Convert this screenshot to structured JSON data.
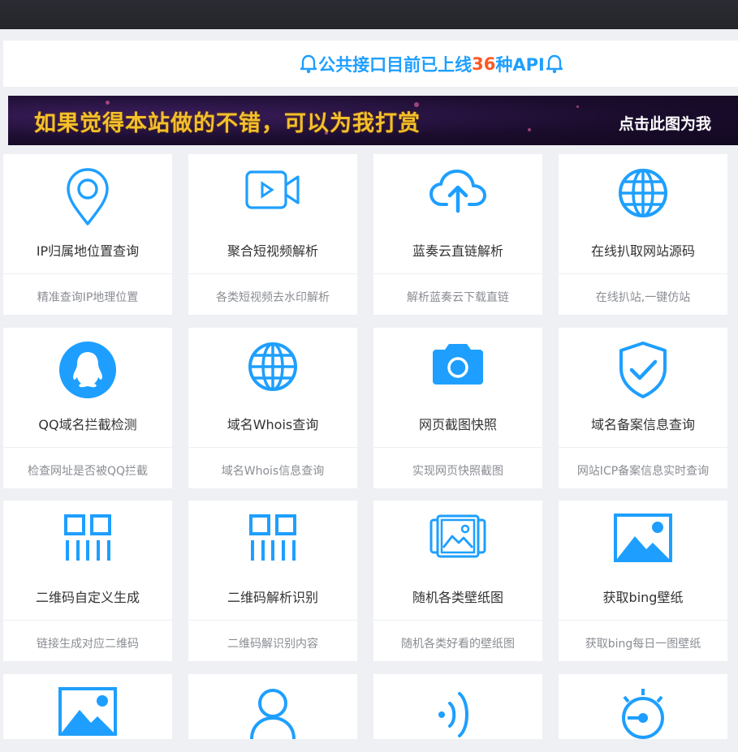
{
  "notice": {
    "prefix": "公共接口目前已上线",
    "count": "36",
    "suffix": "种API"
  },
  "banner": {
    "text": "如果觉得本站做的不错，可以为我打赏",
    "side_text": "点击此图为我"
  },
  "colors": {
    "accent": "#1e9fff",
    "highlight": "#ff5722",
    "banner_gold": "#f4c02c"
  },
  "cards": [
    {
      "icon": "location-pin-icon",
      "title": "IP归属地位置查询",
      "desc": "精准查询IP地理位置"
    },
    {
      "icon": "video-camera-icon",
      "title": "聚合短视频解析",
      "desc": "各类短视频去水印解析"
    },
    {
      "icon": "cloud-upload-icon",
      "title": "蓝奏云直链解析",
      "desc": "解析蓝奏云下载直链"
    },
    {
      "icon": "globe-icon",
      "title": "在线扒取网站源码",
      "desc": "在线扒站,一键仿站"
    },
    {
      "icon": "qq-penguin-icon",
      "title": "QQ域名拦截检测",
      "desc": "检查网址是否被QQ拦截"
    },
    {
      "icon": "globe-icon",
      "title": "域名Whois查询",
      "desc": "域名Whois信息查询"
    },
    {
      "icon": "camera-icon",
      "title": "网页截图快照",
      "desc": "实现网页快照截图"
    },
    {
      "icon": "shield-check-icon",
      "title": "域名备案信息查询",
      "desc": "网站ICP备案信息实时查询"
    },
    {
      "icon": "qrcode-icon",
      "title": "二维码自定义生成",
      "desc": "链接生成对应二维码"
    },
    {
      "icon": "qrcode-icon",
      "title": "二维码解析识别",
      "desc": "二维码解识别内容"
    },
    {
      "icon": "photo-gallery-icon",
      "title": "随机各类壁纸图",
      "desc": "随机各类好看的壁纸图"
    },
    {
      "icon": "image-icon",
      "title": "获取bing壁纸",
      "desc": "获取bing每日一图壁纸"
    },
    {
      "icon": "image-icon",
      "title": "",
      "desc": ""
    },
    {
      "icon": "user-icon",
      "title": "",
      "desc": ""
    },
    {
      "icon": "signal-icon",
      "title": "",
      "desc": ""
    },
    {
      "icon": "gauge-icon",
      "title": "",
      "desc": ""
    }
  ]
}
